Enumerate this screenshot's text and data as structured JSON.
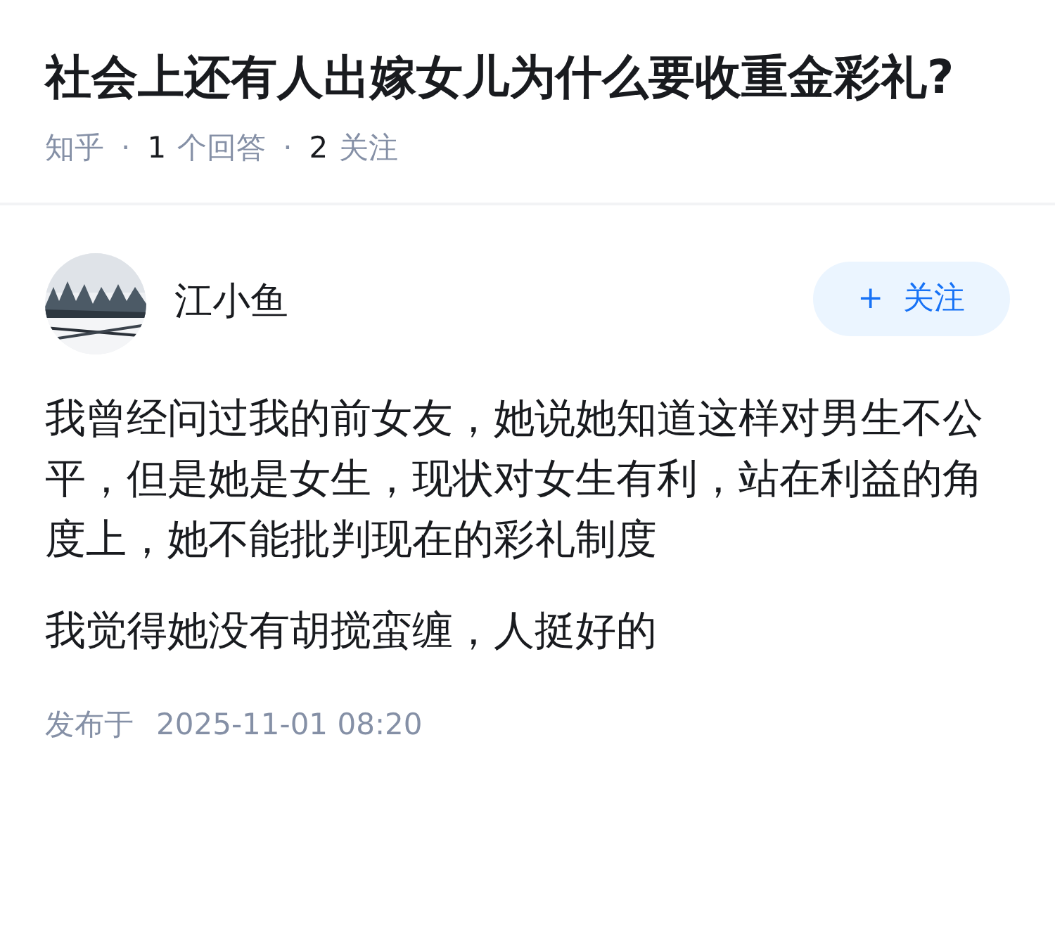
{
  "question": {
    "title": "社会上还有人出嫁女儿为什么要收重金彩礼?",
    "source": "知乎",
    "separator": "·",
    "answers_count": "1",
    "answers_label": "个回答",
    "followers_count": "2",
    "followers_label": "关注"
  },
  "answer": {
    "author": "江小鱼",
    "follow_button": {
      "icon": "+",
      "label": "关注"
    },
    "paragraphs": [
      "我曾经问过我的前女友，她说她知道这样对男生不公平，但是她是女生，现状对女生有利，站在利益的角度上，她不能批判现在的彩礼制度",
      "我觉得她没有胡搅蛮缠，人挺好的"
    ],
    "published_label": "发布于",
    "published_time": "2025-11-01 08:20"
  }
}
